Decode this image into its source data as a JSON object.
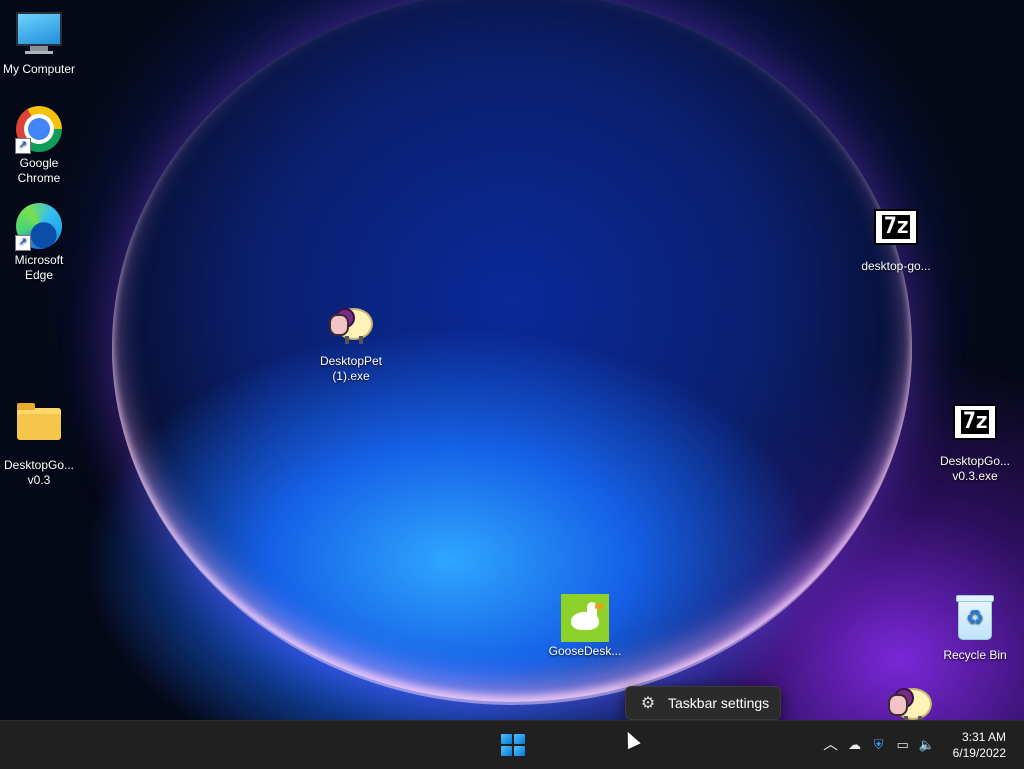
{
  "desktop": {
    "icons": [
      {
        "label": "My Computer"
      },
      {
        "label": "Google\nChrome"
      },
      {
        "label": "Microsoft\nEdge"
      },
      {
        "label": "DesktopGo...\nv0.3"
      },
      {
        "label": "DesktopPet\n(1).exe"
      },
      {
        "label": "desktop-go..."
      },
      {
        "label": "DesktopGo...\nv0.3.exe"
      },
      {
        "label": "GooseDesk..."
      },
      {
        "label": "Recycle Bin"
      }
    ],
    "shortcut_arrow": "↗"
  },
  "context_menu": {
    "items": [
      {
        "label": "Taskbar settings",
        "icon": "gear-icon"
      }
    ]
  },
  "taskbar": {
    "start_icon": "windows-start-icon",
    "tray": {
      "chevron": "^",
      "icons": [
        "onedrive-icon",
        "security-warning-icon",
        "network-icon",
        "volume-icon"
      ]
    },
    "clock": {
      "time": "3:31 AM",
      "date": "6/19/2022"
    }
  },
  "colors": {
    "taskbar_bg": "#202020",
    "accent": "#0a78d7"
  }
}
